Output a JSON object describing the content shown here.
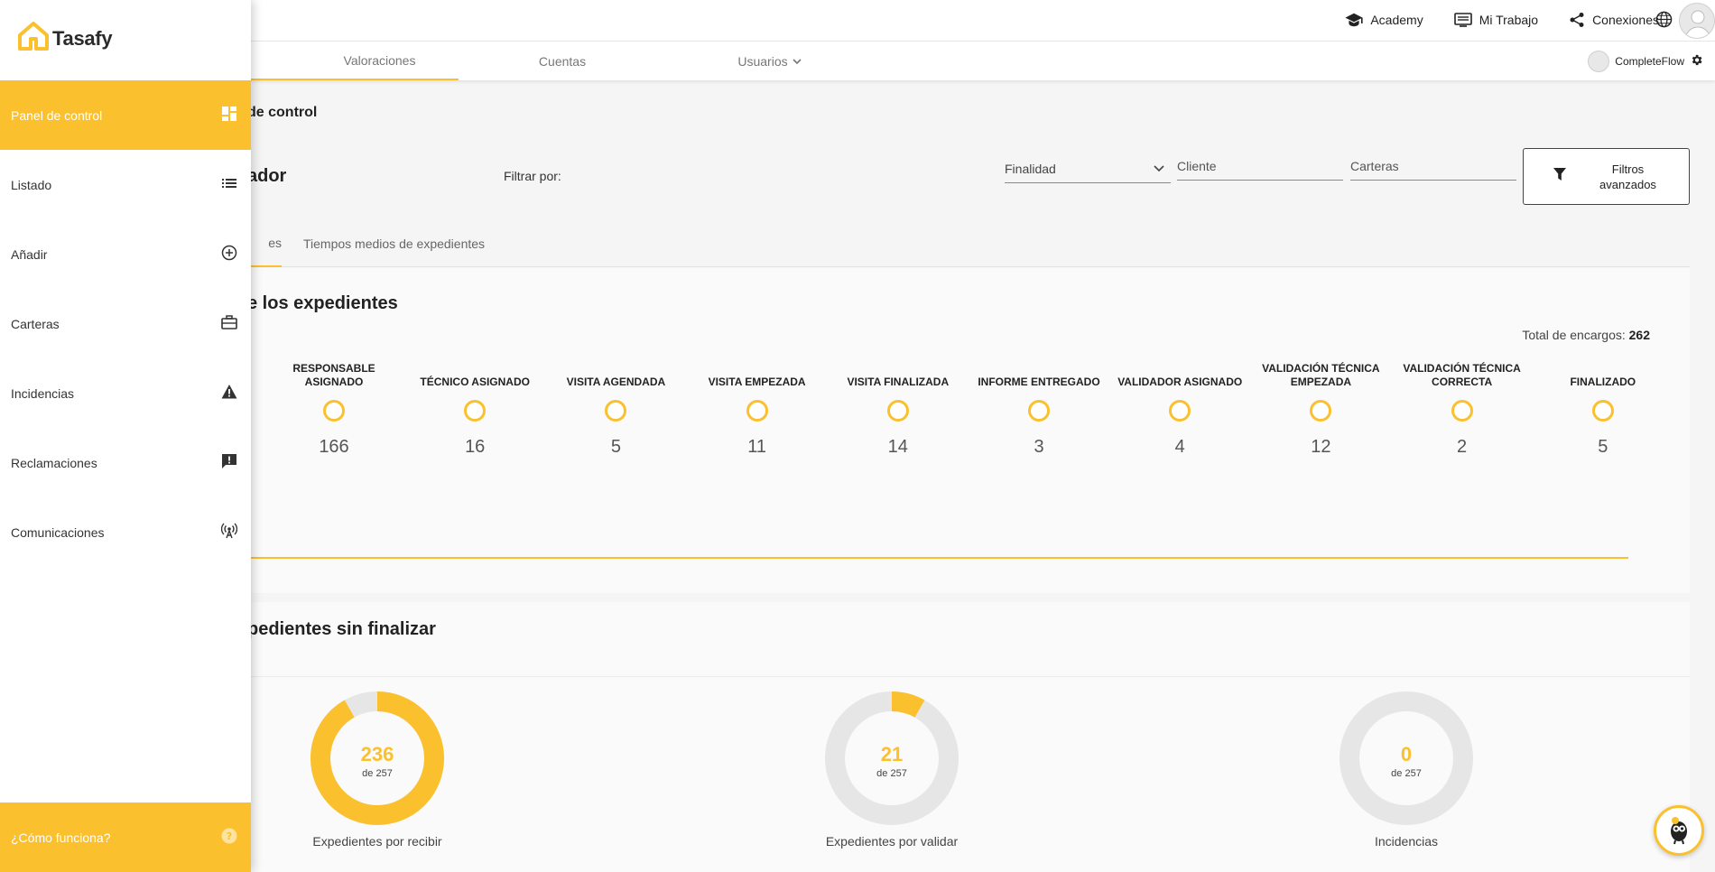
{
  "app": {
    "logo_text": "Tasafy"
  },
  "topbar": {
    "links": [
      {
        "label": "Academy",
        "icon": "graduation-cap-icon"
      },
      {
        "label": "Mi Trabajo",
        "icon": "monitor-list-icon"
      },
      {
        "label": "Conexiones",
        "icon": "share-icon"
      }
    ],
    "globe_icon": "globe-icon"
  },
  "nav": {
    "tabs": [
      {
        "label": "Valoraciones",
        "active": true
      },
      {
        "label": "Cuentas",
        "active": false
      },
      {
        "label": "Usuarios",
        "active": false,
        "dropdown": true
      }
    ],
    "user_name": "CompleteFlow"
  },
  "sidebar": {
    "items": [
      {
        "label": "Panel de control",
        "icon": "dashboard-icon",
        "active": true
      },
      {
        "label": "Listado",
        "icon": "list-icon",
        "active": false
      },
      {
        "label": "Añadir",
        "icon": "add-circle-icon",
        "active": false
      },
      {
        "label": "Carteras",
        "icon": "briefcase-icon",
        "active": false
      },
      {
        "label": "Incidencias",
        "icon": "warning-icon",
        "active": false
      },
      {
        "label": "Reclamaciones",
        "icon": "feedback-icon",
        "active": false
      },
      {
        "label": "Comunicaciones",
        "icon": "antenna-icon",
        "active": false
      }
    ],
    "help_label": "¿Cómo funciona?"
  },
  "page": {
    "breadcrumb_title": "de control",
    "heading": "ador",
    "filter_label": "Filtrar por:",
    "filters": {
      "finalidad_value": "Finalidad",
      "cliente_placeholder": "Cliente",
      "carteras_placeholder": "Carteras",
      "advanced_label": "Filtros avanzados"
    },
    "subtabs": [
      {
        "label": "es",
        "active": true
      },
      {
        "label": "Tiempos medios de expedientes",
        "active": false
      }
    ]
  },
  "status_card": {
    "title": "e los expedientes",
    "total_label": "Total de encargos:",
    "total_value": "262",
    "steps": [
      {
        "label": "RESPONSABLE ASIGNADO",
        "count": "166"
      },
      {
        "label": "TÉCNICO ASIGNADO",
        "count": "16"
      },
      {
        "label": "VISITA AGENDADA",
        "count": "5"
      },
      {
        "label": "VISITA EMPEZADA",
        "count": "11"
      },
      {
        "label": "VISITA FINALIZADA",
        "count": "14"
      },
      {
        "label": "INFORME ENTREGADO",
        "count": "3"
      },
      {
        "label": "VALIDADOR ASIGNADO",
        "count": "4"
      },
      {
        "label": "VALIDACIÓN TÉCNICA EMPEZADA",
        "count": "12"
      },
      {
        "label": "VALIDACIÓN TÉCNICA CORRECTA",
        "count": "2"
      },
      {
        "label": "FINALIZADO",
        "count": "5"
      }
    ]
  },
  "unfinished_card": {
    "title": "pedientes sin finalizar",
    "donuts": [
      {
        "value": 236,
        "value_label": "236",
        "of_label": "de 257",
        "caption": "Expedientes por recibir"
      },
      {
        "value": 21,
        "value_label": "21",
        "of_label": "de 257",
        "caption": "Expedientes por validar"
      },
      {
        "value": 0,
        "value_label": "0",
        "of_label": "de 257",
        "caption": "Incidencias"
      }
    ],
    "total": 257
  },
  "colors": {
    "accent": "#fbc02d",
    "track": "#e6e6e6"
  }
}
